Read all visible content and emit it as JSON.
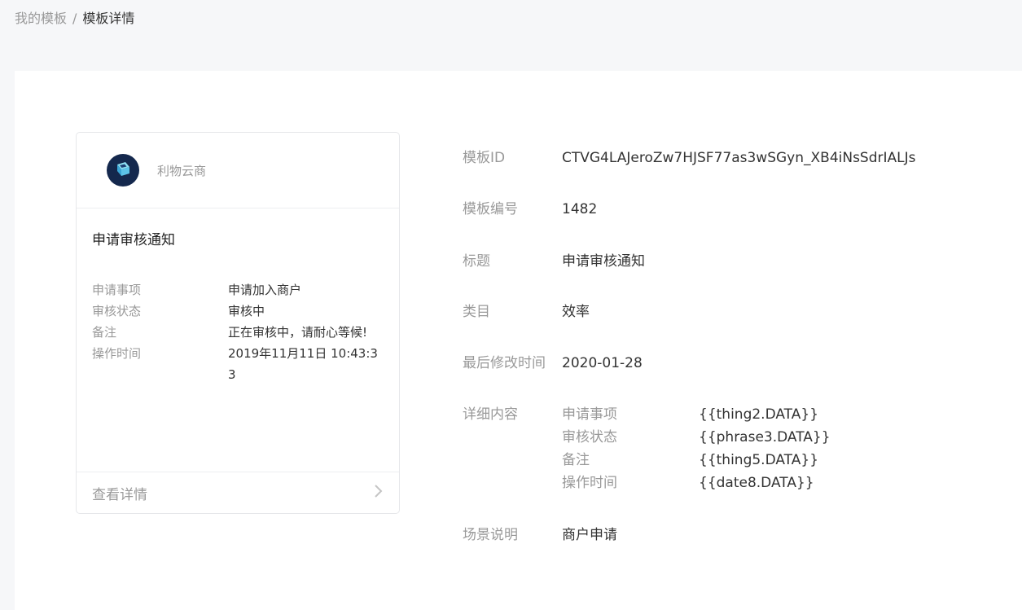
{
  "breadcrumb": {
    "parent": "我的模板",
    "separator": "/",
    "current": "模板详情"
  },
  "preview_card": {
    "brand": {
      "name": "利物云商",
      "avatar_icon": "cube-logo-icon",
      "avatar_color": "#14284d"
    },
    "title": "申请审核通知",
    "fields": [
      {
        "label": "申请事项",
        "value": "申请加入商户"
      },
      {
        "label": "审核状态",
        "value": "审核中"
      },
      {
        "label": "备注",
        "value": "正在审核中，请耐心等候!"
      },
      {
        "label": "操作时间",
        "value": "2019年11月11日 10:43:33"
      }
    ],
    "footer": {
      "label": "查看详情",
      "icon": "chevron-right-icon"
    }
  },
  "details": {
    "template_id": {
      "label": "模板ID",
      "value": "CTVG4LAJeroZw7HJSF77as3wSGyn_XB4iNsSdrIALJs"
    },
    "template_number": {
      "label": "模板编号",
      "value": "1482"
    },
    "title": {
      "label": "标题",
      "value": "申请审核通知"
    },
    "category": {
      "label": "类目",
      "value": "效率"
    },
    "last_modified": {
      "label": "最后修改时间",
      "value": "2020-01-28"
    },
    "content": {
      "label": "详细内容",
      "items": [
        {
          "key": "申请事项",
          "value": "{{thing2.DATA}}"
        },
        {
          "key": "审核状态",
          "value": "{{phrase3.DATA}}"
        },
        {
          "key": "备注",
          "value": "{{thing5.DATA}}"
        },
        {
          "key": "操作时间",
          "value": "{{date8.DATA}}"
        }
      ]
    },
    "scene": {
      "label": "场景说明",
      "value": "商户申请"
    }
  }
}
